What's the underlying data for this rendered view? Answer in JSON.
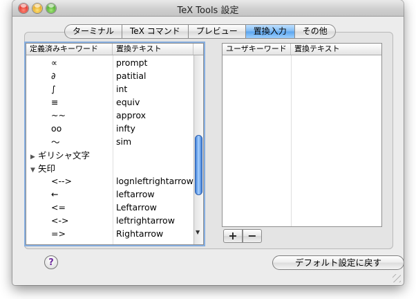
{
  "window": {
    "title": "TeX Tools 設定"
  },
  "tabs": [
    {
      "label": "ターミナル",
      "active": false
    },
    {
      "label": "TeX コマンド",
      "active": false
    },
    {
      "label": "プレビュー",
      "active": false
    },
    {
      "label": "置換入力",
      "active": true
    },
    {
      "label": "その他",
      "active": false
    }
  ],
  "predefined_table": {
    "headers": [
      "定義済みキーワード",
      "置換テキスト"
    ],
    "rows": [
      {
        "keyword": "∝",
        "replacement": "prompt",
        "kind": "item"
      },
      {
        "keyword": "∂",
        "replacement": "patitial",
        "kind": "item"
      },
      {
        "keyword": "∫",
        "replacement": "int",
        "kind": "item"
      },
      {
        "keyword": "≡",
        "replacement": "equiv",
        "kind": "item"
      },
      {
        "keyword": "~~",
        "replacement": "approx",
        "kind": "item"
      },
      {
        "keyword": "oo",
        "replacement": "infty",
        "kind": "item"
      },
      {
        "keyword": "〜",
        "replacement": "sim",
        "kind": "item"
      },
      {
        "keyword": "ギリシャ文字",
        "replacement": "",
        "kind": "group",
        "disclosure": "▶"
      },
      {
        "keyword": "矢印",
        "replacement": "",
        "kind": "group",
        "disclosure": "▼"
      },
      {
        "keyword": "<-->",
        "replacement": "lognleftrightarrow",
        "kind": "item"
      },
      {
        "keyword": "←",
        "replacement": "leftarrow",
        "kind": "item"
      },
      {
        "keyword": "<=",
        "replacement": "Leftarrow",
        "kind": "item"
      },
      {
        "keyword": "<->",
        "replacement": "leftrightarrow",
        "kind": "item"
      },
      {
        "keyword": "=>",
        "replacement": "Rightarrow",
        "kind": "item"
      }
    ]
  },
  "user_table": {
    "headers": [
      "ユーザキーワード",
      "置換テキスト"
    ],
    "rows": []
  },
  "buttons": {
    "add": "+",
    "remove": "−",
    "help": "?",
    "restore_defaults": "デフォルト設定に戻す"
  }
}
